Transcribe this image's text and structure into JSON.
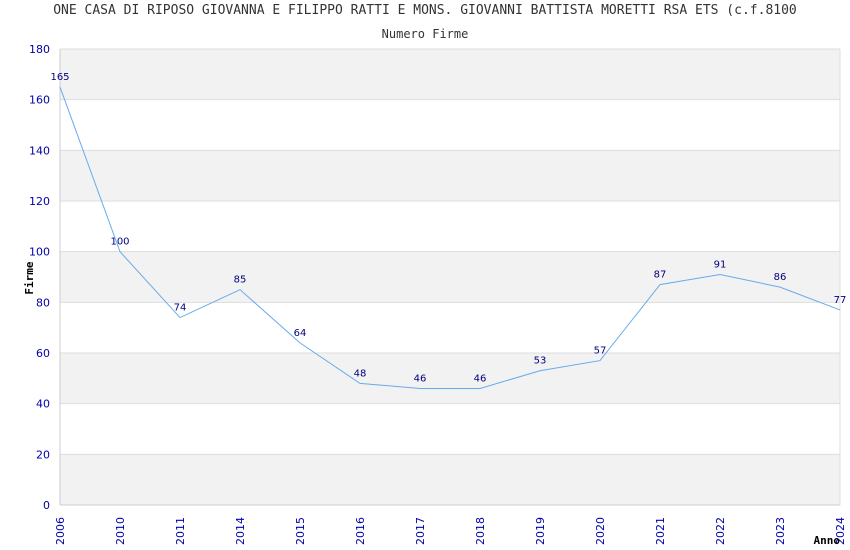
{
  "chart_data": {
    "type": "line",
    "title": "ONE CASA DI RIPOSO GIOVANNA E FILIPPO RATTI E MONS. GIOVANNI BATTISTA MORETTI RSA ETS (c.f.8100",
    "subtitle": "Numero Firme",
    "xlabel": "Anno",
    "ylabel": "Firme",
    "ylim": [
      0,
      180
    ],
    "yticks": [
      0,
      20,
      40,
      60,
      80,
      100,
      120,
      140,
      160,
      180
    ],
    "categories": [
      "2006",
      "2010",
      "2011",
      "2014",
      "2015",
      "2016",
      "2017",
      "2018",
      "2019",
      "2020",
      "2021",
      "2022",
      "2023",
      "2024"
    ],
    "series": [
      {
        "values": [
          165,
          100,
          74,
          85,
          64,
          48,
          46,
          46,
          53,
          57,
          87,
          91,
          86,
          77
        ]
      }
    ],
    "grid": true,
    "line_color": "#66aaee",
    "band_color": "#f2f2f2"
  }
}
